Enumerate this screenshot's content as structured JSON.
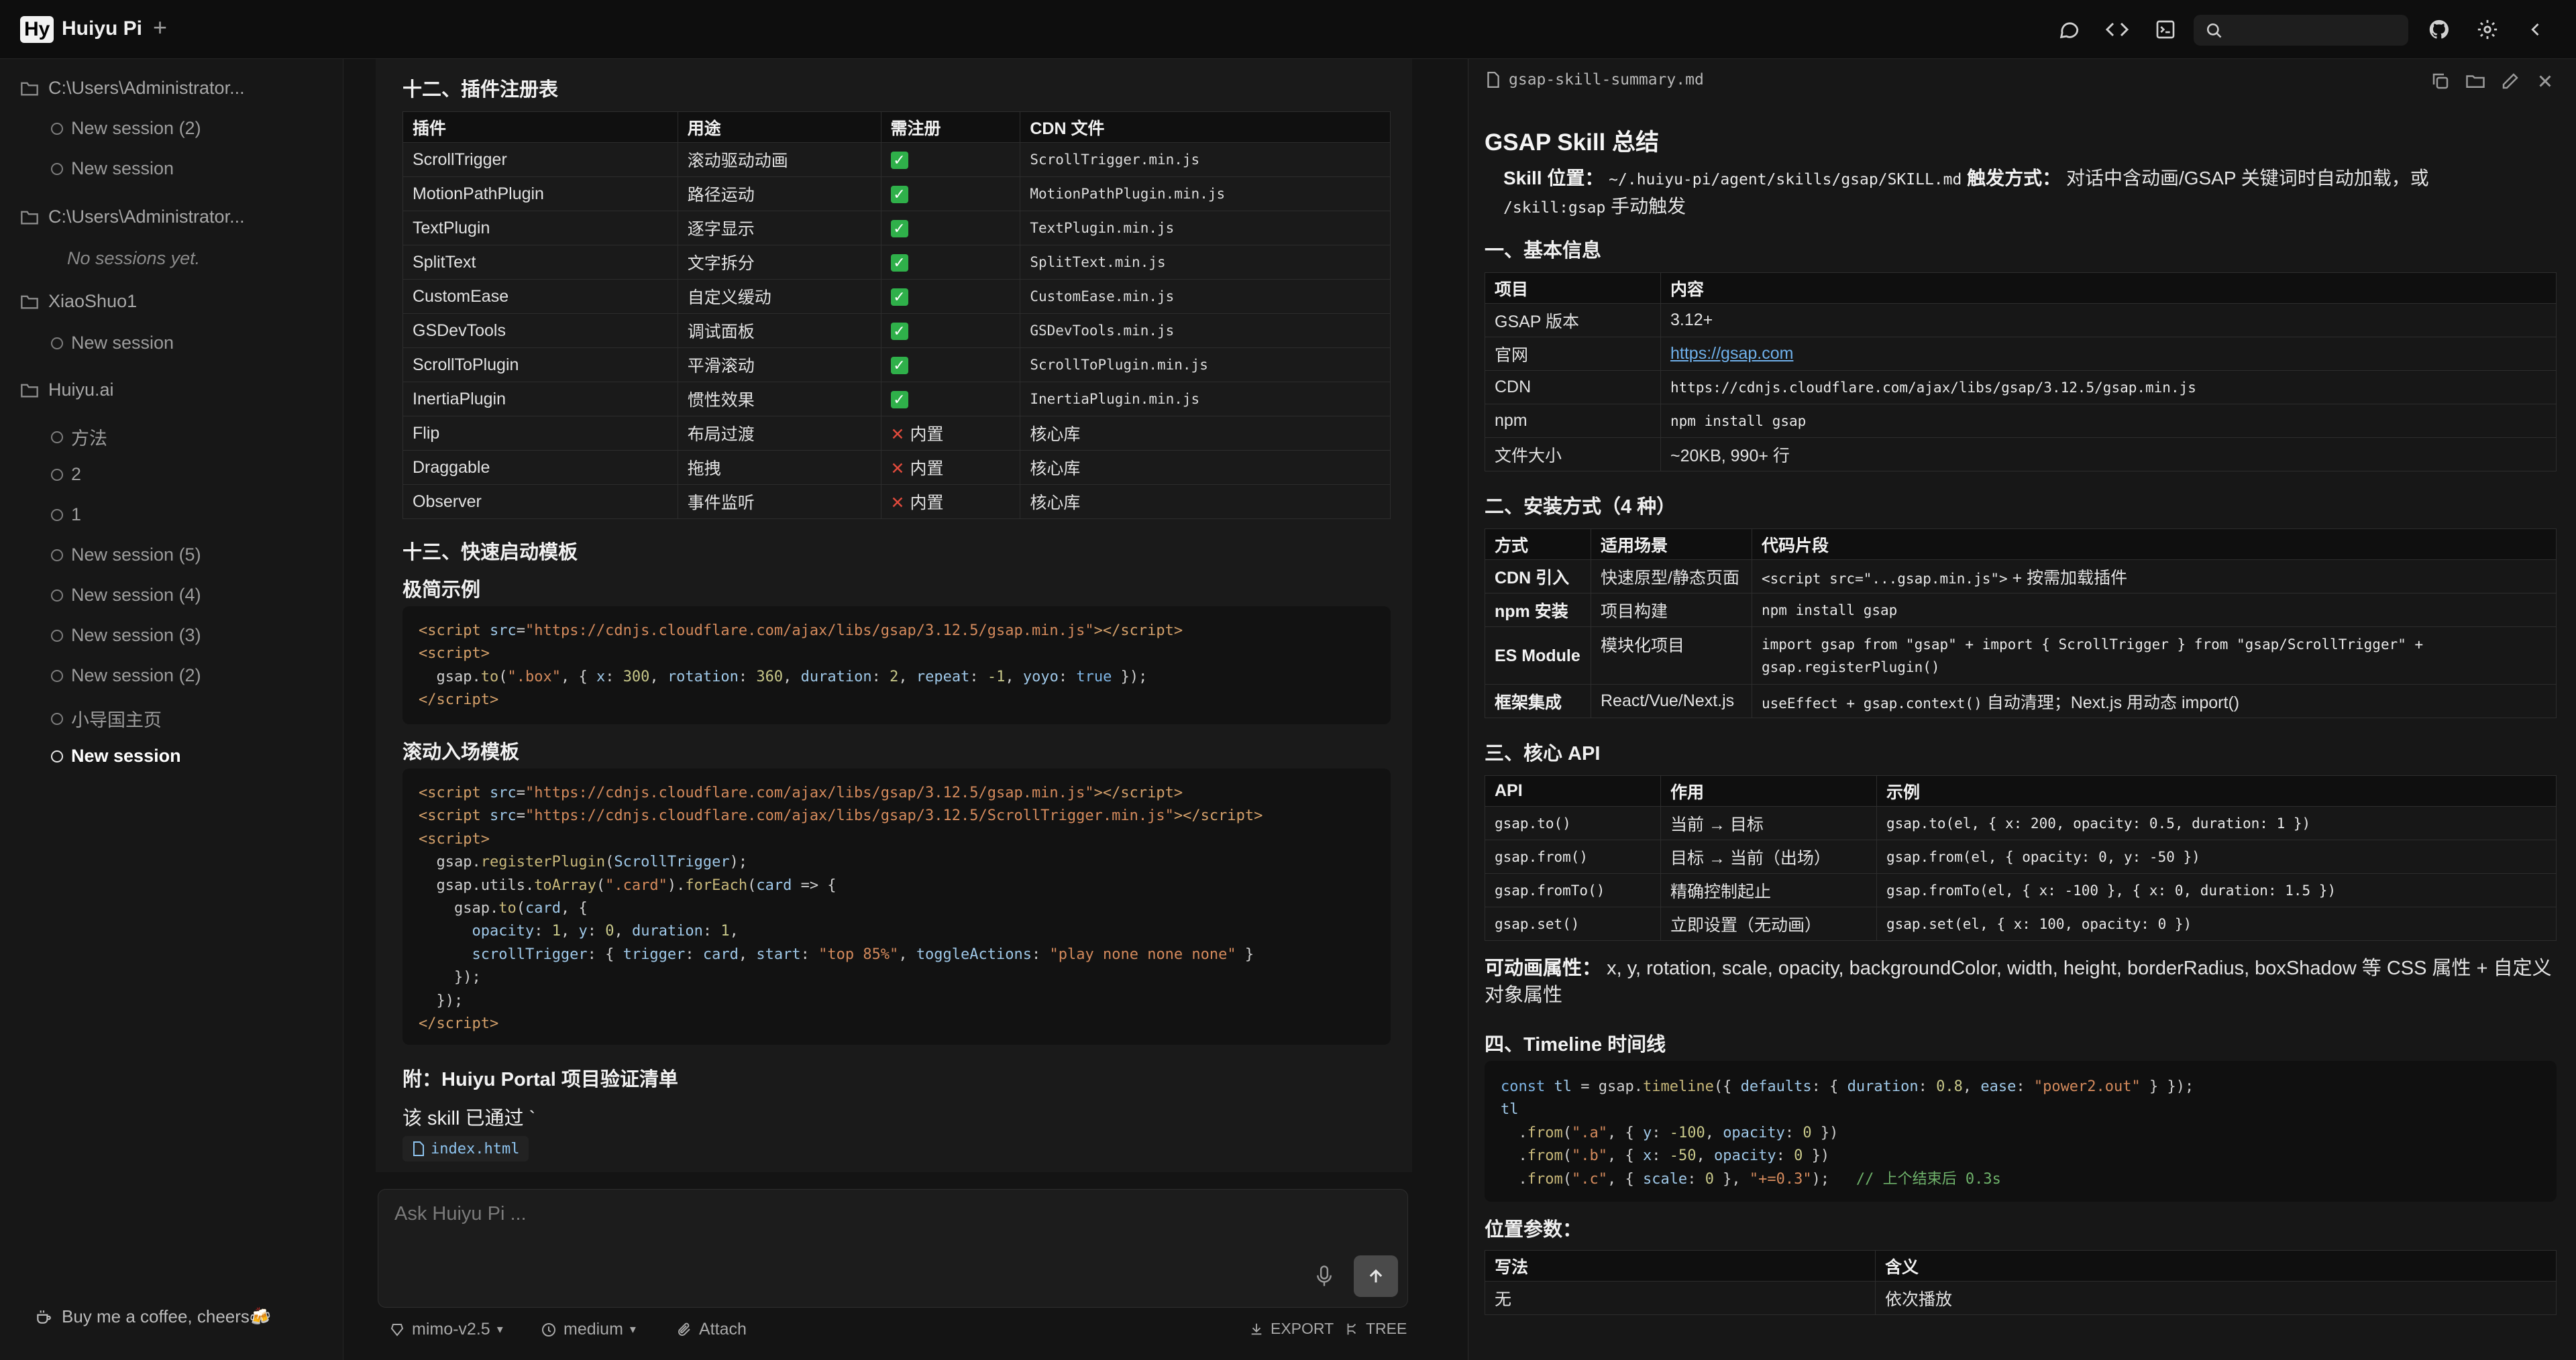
{
  "app": {
    "logo": "Hy",
    "title": "Huiyu Pi"
  },
  "sidebar": {
    "groups": [
      {
        "folder": "C:\\Users\\Administrator...",
        "sessions": [
          "New session (2)",
          "New session"
        ]
      },
      {
        "folder": "C:\\Users\\Administrator...",
        "empty": "No sessions yet."
      },
      {
        "folder": "XiaoShuo1",
        "sessions": [
          "New session"
        ]
      },
      {
        "folder": "Huiyu.ai",
        "sessions": [
          "方法",
          "2",
          "1",
          "New session (5)",
          "New session (4)",
          "New session (3)",
          "New session (2)",
          "小导国主页",
          "New session"
        ]
      }
    ],
    "coffee": "Buy me a coffee, cheers🍻"
  },
  "center": {
    "section12": "十二、插件注册表",
    "plugin_table": {
      "headers": [
        "插件",
        "用途",
        "需注册",
        "CDN 文件"
      ],
      "rows": [
        [
          "ScrollTrigger",
          "滚动驱动动画",
          "yes",
          "ScrollTrigger.min.js"
        ],
        [
          "MotionPathPlugin",
          "路径运动",
          "yes",
          "MotionPathPlugin.min.js"
        ],
        [
          "TextPlugin",
          "逐字显示",
          "yes",
          "TextPlugin.min.js"
        ],
        [
          "SplitText",
          "文字拆分",
          "yes",
          "SplitText.min.js"
        ],
        [
          "CustomEase",
          "自定义缓动",
          "yes",
          "CustomEase.min.js"
        ],
        [
          "GSDevTools",
          "调试面板",
          "yes",
          "GSDevTools.min.js"
        ],
        [
          "ScrollToPlugin",
          "平滑滚动",
          "yes",
          "ScrollToPlugin.min.js"
        ],
        [
          "InertiaPlugin",
          "惯性效果",
          "yes",
          "InertiaPlugin.min.js"
        ],
        [
          "Flip",
          "布局过渡",
          "内置",
          "核心库"
        ],
        [
          "Draggable",
          "拖拽",
          "内置",
          "核心库"
        ],
        [
          "Observer",
          "事件监听",
          "内置",
          "核心库"
        ]
      ]
    },
    "section13": "十三、快速启动模板",
    "minimal_title": "极简示例",
    "scroll_title": "滚动入场模板",
    "appendix_title": "附：Huiyu Portal 项目验证清单",
    "appendix_text": "该 skill 已通过 `",
    "file_chip": "index.html"
  },
  "composer": {
    "placeholder": "Ask Huiyu Pi ...",
    "model": "mimo-v2.5",
    "effort": "medium",
    "attach": "Attach",
    "export": "EXPORT",
    "tree": "TREE"
  },
  "right": {
    "filename": "gsap-skill-summary.md",
    "title": "GSAP Skill 总结",
    "location_label": "Skill 位置：",
    "location_value": "~/.huiyu-pi/agent/skills/gsap/SKILL.md",
    "trigger_label": "触发方式：",
    "trigger_text": "对话中含动画/GSAP 关键词时自动加载，或",
    "trigger_cmd": "/skill:gsap",
    "trigger_tail": "手动触发",
    "basic_title": "一、基本信息",
    "basic_table": {
      "headers": [
        "项目",
        "内容"
      ],
      "rows": [
        [
          "GSAP 版本",
          "3.12+"
        ],
        [
          "官网",
          "https://gsap.com"
        ],
        [
          "CDN",
          "https://cdnjs.cloudflare.com/ajax/libs/gsap/3.12.5/gsap.min.js"
        ],
        [
          "npm",
          "npm install gsap"
        ],
        [
          "文件大小",
          "~20KB, 990+ 行"
        ]
      ]
    },
    "install_title": "二、安装方式（4 种）",
    "install_table": {
      "headers": [
        "方式",
        "适用场景",
        "代码片段"
      ],
      "rows": [
        [
          "CDN 引入",
          "快速原型/静态页面",
          "<script src=\"...gsap.min.js\">",
          "+ 按需加载插件"
        ],
        [
          "npm 安装",
          "项目构建",
          "npm install gsap",
          ""
        ],
        [
          "ES Module",
          "模块化项目",
          "import gsap from \"gsap\" + import { ScrollTrigger } from \"gsap/ScrollTrigger\" + gsap.registerPlugin()",
          ""
        ],
        [
          "框架集成",
          "React/Vue/Next.js",
          "useEffect + gsap.context()",
          "自动清理；Next.js 用动态 import()"
        ]
      ]
    },
    "api_title": "三、核心 API",
    "api_table": {
      "headers": [
        "API",
        "作用",
        "示例"
      ],
      "rows": [
        [
          "gsap.to()",
          "当前 → 目标",
          "gsap.to(el, { x: 200, opacity: 0.5, duration: 1 })"
        ],
        [
          "gsap.from()",
          "目标 → 当前（出场）",
          "gsap.from(el, { opacity: 0, y: -50 })"
        ],
        [
          "gsap.fromTo()",
          "精确控制起止",
          "gsap.fromTo(el, { x: -100 }, { x: 0, duration: 1.5 })"
        ],
        [
          "gsap.set()",
          "立即设置（无动画）",
          "gsap.set(el, { x: 100, opacity: 0 })"
        ]
      ]
    },
    "anim_label": "可动画属性：",
    "anim_text": "x, y, rotation, scale, opacity, backgroundColor, width, height, borderRadius, boxShadow 等 CSS 属性 + 自定义对象属性",
    "timeline_title": "四、Timeline 时间线",
    "position_title": "位置参数：",
    "position_table": {
      "headers": [
        "写法",
        "含义"
      ],
      "rows": [
        [
          "无",
          "依次播放"
        ]
      ]
    }
  }
}
